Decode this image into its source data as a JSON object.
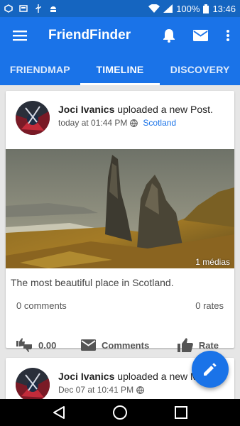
{
  "status_bar": {
    "battery": "100%",
    "time": "13:46"
  },
  "app_bar": {
    "title": "FriendFinder"
  },
  "tabs": [
    {
      "label": "FRIENDMAP",
      "active": false
    },
    {
      "label": "TIMELINE",
      "active": true
    },
    {
      "label": "DISCOVERY",
      "active": false
    }
  ],
  "posts": [
    {
      "author": "Joci Ivanics",
      "action_text": " uploaded a new Post.",
      "time": "today at 01:44 PM",
      "location": "Scotland",
      "media_count": "1 médias",
      "text": "The most beautiful place in Scotland.",
      "comments_count": "0 comments",
      "rates_count": "0 rates",
      "vote_value": "0.00",
      "comments_label": "Comments",
      "rate_label": "Rate"
    },
    {
      "author": "Joci Ivanics",
      "action_text": " uploaded a new Med",
      "time": "Dec 07 at 10:41 PM"
    }
  ],
  "colors": {
    "primary": "#1a73e8",
    "status_bar": "#1565c0",
    "link": "#1a73e8"
  }
}
